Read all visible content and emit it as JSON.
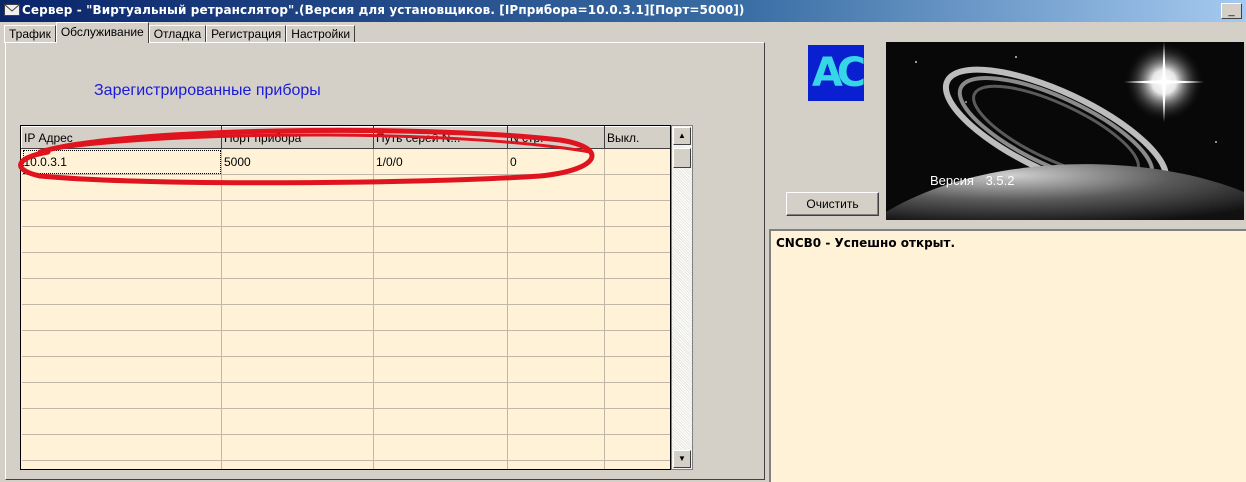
{
  "window": {
    "title": "Сервер - \"Виртуальный ретранслятор\".(Версия для установщиков. [IPприбора=10.0.3.1][Порт=5000])",
    "minimize_label": "_"
  },
  "tabs": [
    {
      "label": "Трафик"
    },
    {
      "label": "Обслуживание"
    },
    {
      "label": "Отладка"
    },
    {
      "label": "Регистрация"
    },
    {
      "label": "Настройки"
    }
  ],
  "active_tab": "Обслуживание",
  "panel": {
    "heading": "Зарегистрированные приборы",
    "grid": {
      "columns": [
        "IP Адрес",
        "Порт прибора",
        "Путь серей N...",
        "N стр.",
        "Выкл."
      ],
      "rows": [
        [
          "10.0.3.1",
          "5000",
          "1/0/0",
          "0",
          ""
        ]
      ],
      "empty_row_count": 12
    }
  },
  "right": {
    "logo_text": "АС",
    "version_label": "Версия",
    "version_number": "3.5.2",
    "clear_button": "Очистить",
    "log_lines": [
      "CNCB0 - Успешно открыт."
    ]
  },
  "colors": {
    "titlebar": "#0a246a",
    "window_bg": "#d4d0c8",
    "grid_bg": "#fff2d6",
    "heading": "#1a1ad8",
    "annotation": "#e0141e",
    "logo_bg": "#0a1fd0"
  }
}
